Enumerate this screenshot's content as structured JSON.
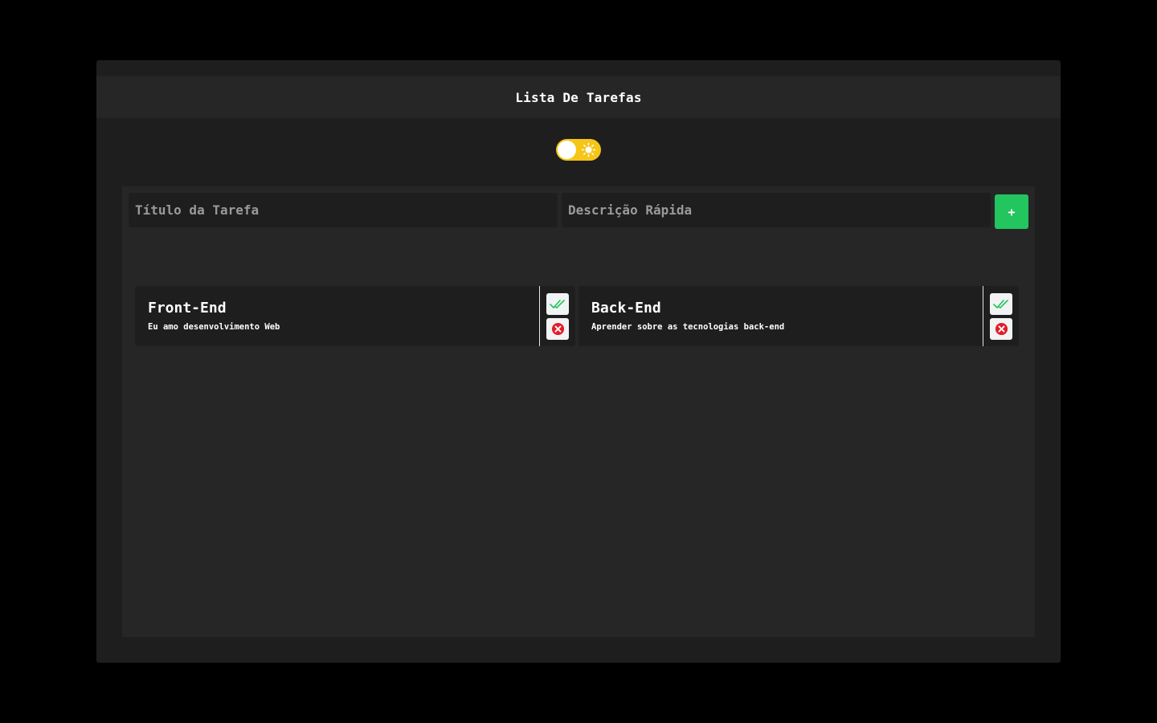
{
  "header": {
    "title": "Lista De Tarefas"
  },
  "theme_toggle": {
    "state": "light-mode-switch",
    "icon": "sun-icon",
    "track_color": "#f5c518"
  },
  "form": {
    "title_placeholder": "Título da Tarefa",
    "description_placeholder": "Descrição Rápida",
    "add_label": "+",
    "add_color": "#22c55e"
  },
  "tasks": [
    {
      "title": "Front-End",
      "description": "Eu amo desenvolvimento Web",
      "complete_icon": "double-check-icon",
      "delete_icon": "close-circle-icon"
    },
    {
      "title": "Back-End",
      "description": "Aprender sobre as tecnologias back-end",
      "complete_icon": "double-check-icon",
      "delete_icon": "close-circle-icon"
    }
  ],
  "colors": {
    "background": "#000000",
    "window": "#1e1e1e",
    "panel": "#262626",
    "check": "#22c55e",
    "delete": "#e11d2a"
  }
}
